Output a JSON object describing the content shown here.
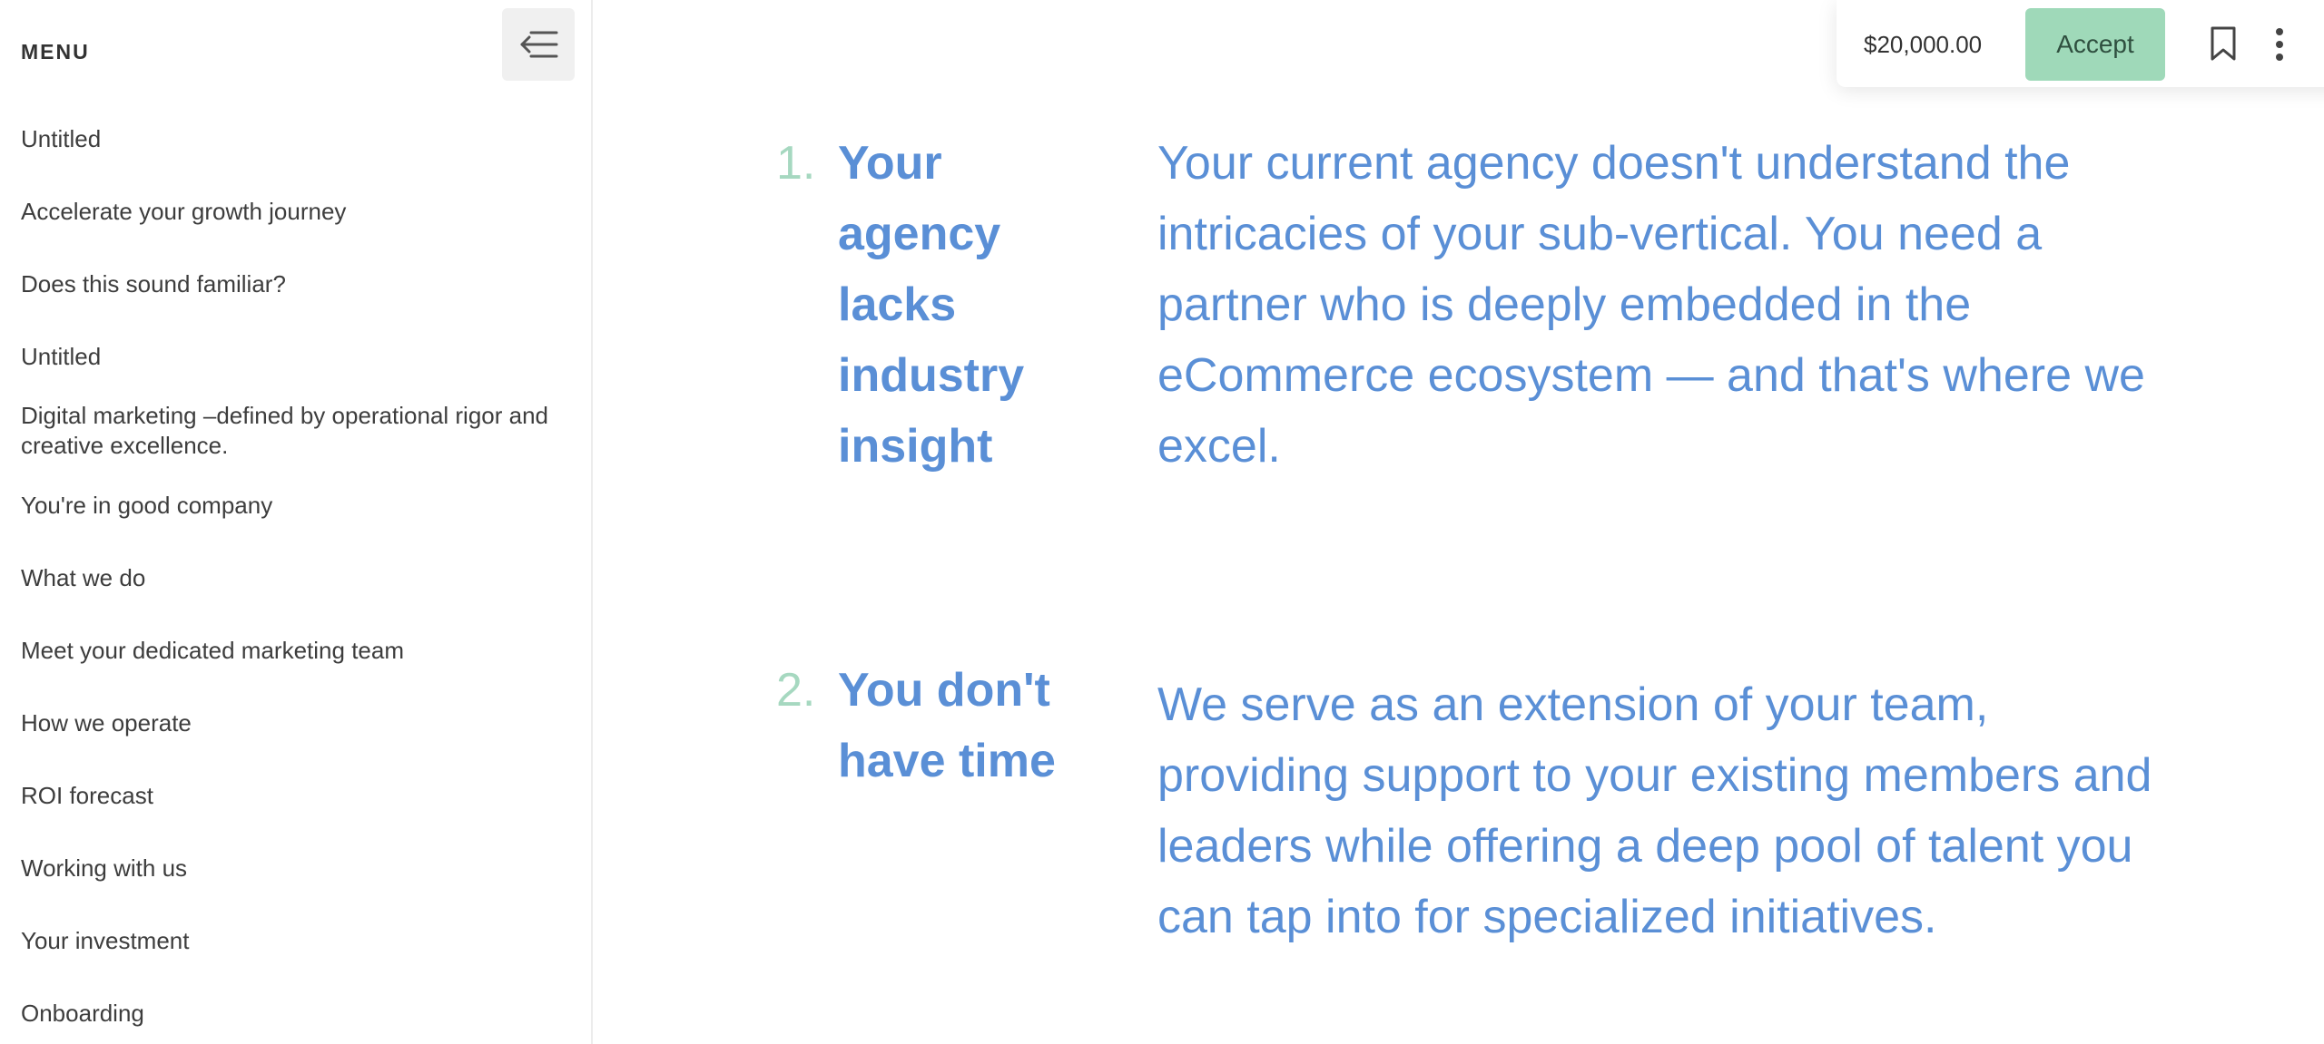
{
  "sidebar": {
    "menu_title": "MENU",
    "items": [
      {
        "label": "Untitled"
      },
      {
        "label": "Accelerate your growth journey"
      },
      {
        "label": "Does this sound familiar?"
      },
      {
        "label": "Untitled"
      },
      {
        "label": "Digital marketing –defined by operational rigor and creative excellence."
      },
      {
        "label": "You're in good company"
      },
      {
        "label": "What we do"
      },
      {
        "label": "Meet your dedicated marketing team"
      },
      {
        "label": "How we operate"
      },
      {
        "label": "ROI forecast"
      },
      {
        "label": "Working with us"
      },
      {
        "label": "Your investment"
      },
      {
        "label": "Onboarding"
      }
    ]
  },
  "topbar": {
    "price": "$20,000.00",
    "accept_label": "Accept"
  },
  "main": {
    "sections": [
      {
        "number": "1.",
        "heading": "Your agency lacks industry insight",
        "body": "Your current agency doesn't understand the intricacies of your sub-vertical. You need a partner who is deeply embedded in the eCommerce ecosystem — and that's where we excel."
      },
      {
        "number": "2.",
        "heading": "You don't have time",
        "body": "We serve as an extension of your team, providing support to your existing members and leaders while offering a deep pool of talent you can tap into for specialized initiatives."
      }
    ]
  },
  "colors": {
    "accent_blue": "#5a8fd6",
    "accent_green": "#a6d8c0",
    "accept_bg": "#9fd9b9"
  }
}
